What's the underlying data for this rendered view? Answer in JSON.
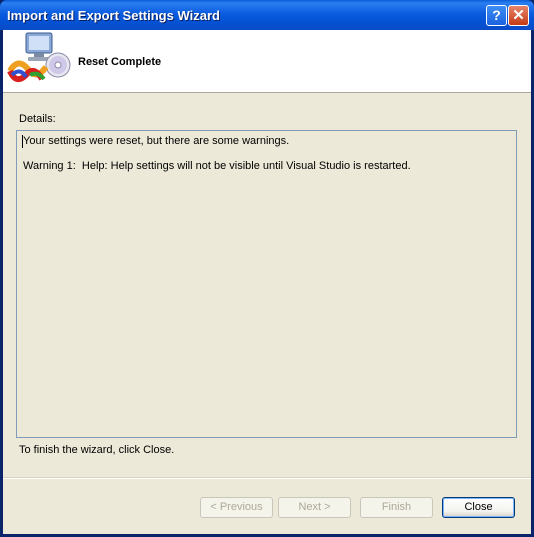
{
  "window": {
    "title": "Import and Export Settings Wizard"
  },
  "titlebar_buttons": {
    "help": "?",
    "close": "✕"
  },
  "header": {
    "title": "Reset Complete",
    "icon": "visual-studio-settings-wizard-icon"
  },
  "details": {
    "label": "Details:",
    "lines": [
      "Your settings were reset, but there are some warnings.",
      "Warning 1:  Help: Help settings will not be visible until Visual Studio is restarted."
    ]
  },
  "footer_text": "To finish the wizard, click Close.",
  "buttons": {
    "previous": "< Previous",
    "next": "Next >",
    "finish": "Finish",
    "close": "Close"
  },
  "colors": {
    "titlebar": "#0553d6",
    "client_bg": "#ece9d8",
    "border": "#7f9db9"
  }
}
